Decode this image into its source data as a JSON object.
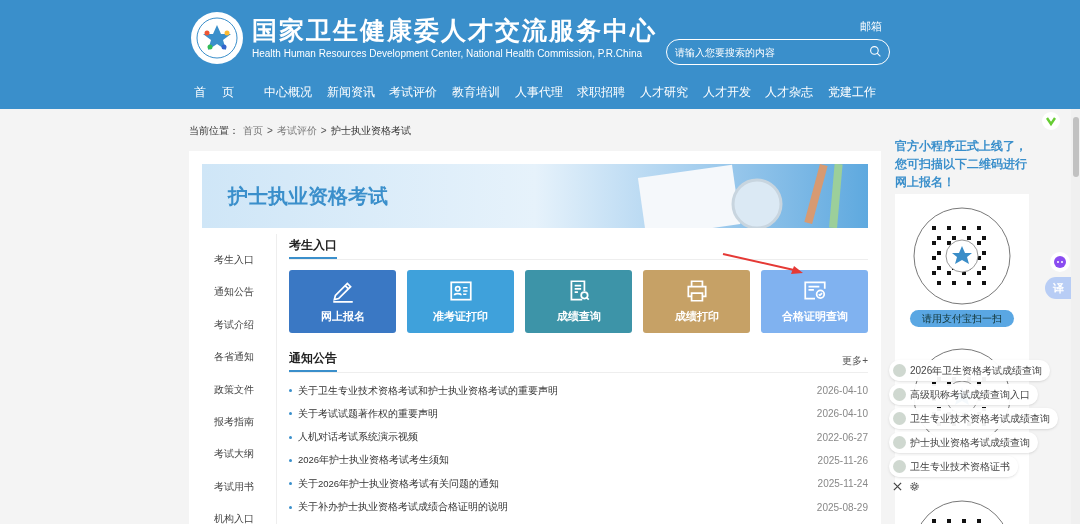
{
  "header": {
    "title": "国家卫生健康委人才交流服务中心",
    "subtitle": "Health Human Resources Development Center, National Health Commission, P.R.China",
    "mail_link": "邮箱",
    "search": {
      "placeholder": "请输入您要搜索的内容"
    },
    "nav": [
      {
        "label": "首页",
        "selected": false
      },
      {
        "label": "中心概况",
        "selected": false
      },
      {
        "label": "新闻资讯",
        "selected": false
      },
      {
        "label": "考试评价",
        "selected": false
      },
      {
        "label": "教育培训",
        "selected": false
      },
      {
        "label": "人事代理",
        "selected": false
      },
      {
        "label": "求职招聘",
        "selected": false
      },
      {
        "label": "人才研究",
        "selected": false
      },
      {
        "label": "人才开发",
        "selected": false
      },
      {
        "label": "人才杂志",
        "selected": false
      },
      {
        "label": "党建工作",
        "selected": false
      }
    ]
  },
  "breadcrumb": {
    "label": "当前位置：",
    "items": [
      "首页",
      "考试评价",
      "护士执业资格考试"
    ],
    "separator": ">"
  },
  "banner": {
    "title": "护士执业资格考试"
  },
  "sidebar": {
    "items": [
      "考生入口",
      "通知公告",
      "考试介绍",
      "各省通知",
      "政策文件",
      "报考指南",
      "考试大纲",
      "考试用书",
      "机构入口"
    ]
  },
  "entry": {
    "title": "考生入口",
    "tiles": [
      {
        "label": "网上报名",
        "kind": "pencil",
        "color": "#3a78c4"
      },
      {
        "label": "准考证打印",
        "kind": "idcard",
        "color": "#3fa1db"
      },
      {
        "label": "成绩查询",
        "kind": "search-doc",
        "color": "#3d94a8"
      },
      {
        "label": "成绩打印",
        "kind": "printer",
        "color": "#c6a166"
      },
      {
        "label": "合格证明查询",
        "kind": "certificate",
        "color": "#80b2f0"
      }
    ]
  },
  "notices": {
    "title": "通知公告",
    "more": "更多+",
    "items": [
      {
        "title": "关于卫生专业技术资格考试和护士执业资格考试的重要声明",
        "date": "2026-04-10"
      },
      {
        "title": "关于考试试题著作权的重要声明",
        "date": "2026-04-10"
      },
      {
        "title": "人机对话考试系统演示视频",
        "date": "2022-06-27"
      },
      {
        "title": "2026年护士执业资格考试考生须知",
        "date": "2025-11-26"
      },
      {
        "title": "关于2026年护士执业资格考试有关问题的通知",
        "date": "2025-11-24"
      },
      {
        "title": "关于补办护士执业资格考试成绩合格证明的说明",
        "date": "2025-08-29"
      }
    ]
  },
  "promo": {
    "text": "官方小程序正式上线了，您可扫描以下二维码进行网上报名！",
    "qr_button": "请用支付宝扫一扫"
  },
  "floating_links": [
    "2026年卫生资格考试成绩查询",
    "高级职称考试成绩查询入口",
    "卫生专业技术资格考试成绩查询",
    "护士执业资格考试成绩查询",
    "卫生专业技术资格证书"
  ],
  "side_tools": {
    "translate": "译"
  }
}
